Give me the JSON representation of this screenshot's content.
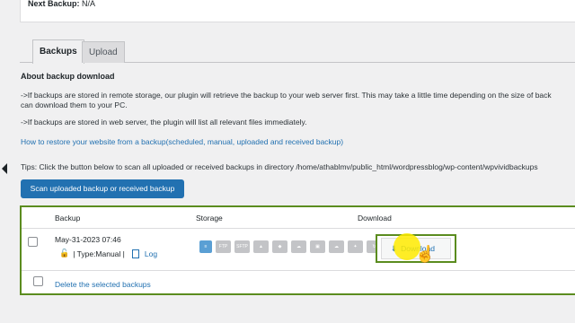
{
  "top": {
    "next_backup_label": "Next Backup:",
    "next_backup_value": " N/A"
  },
  "tabs": [
    {
      "label": "Backups",
      "active": true
    },
    {
      "label": "Upload",
      "active": false
    }
  ],
  "about": {
    "heading": "About backup download",
    "p1_line1": "->If backups are stored in remote storage, our plugin will retrieve the backup to your web server first. This may take a little time depending on the size of back",
    "p1_line2": "can download them to your PC.",
    "p2": "->If backups are stored in web server, the plugin will list all relevant files immediately.",
    "link": "How to restore your website from a backup(scheduled, manual, uploaded and received backup)"
  },
  "tips": "Tips: Click the button below to scan all uploaded or received backups in directory /home/athablmv/public_html/wordpressblog/wp-content/wpvividbackups",
  "scan_button": "Scan uploaded backup or received backup",
  "table": {
    "headers": {
      "backup": "Backup",
      "storage": "Storage",
      "download": "Download"
    },
    "rows": [
      {
        "date": "May-31-2023 07:46",
        "type": "| Type:Manual |",
        "log": "Log",
        "download_label": "Download"
      }
    ],
    "delete_label": "Delete the selected backups"
  },
  "storage_icons": [
    "database-icon",
    "ftp-icon",
    "sftp-icon",
    "google-drive-icon",
    "dropbox-icon",
    "onedrive-icon",
    "amazon-s3-icon",
    "cloud-icon",
    "backblaze-icon",
    "sync-icon"
  ],
  "colors": {
    "accent": "#2271b1",
    "highlight": "#5b8c1f",
    "cursor": "#ffeb00"
  }
}
